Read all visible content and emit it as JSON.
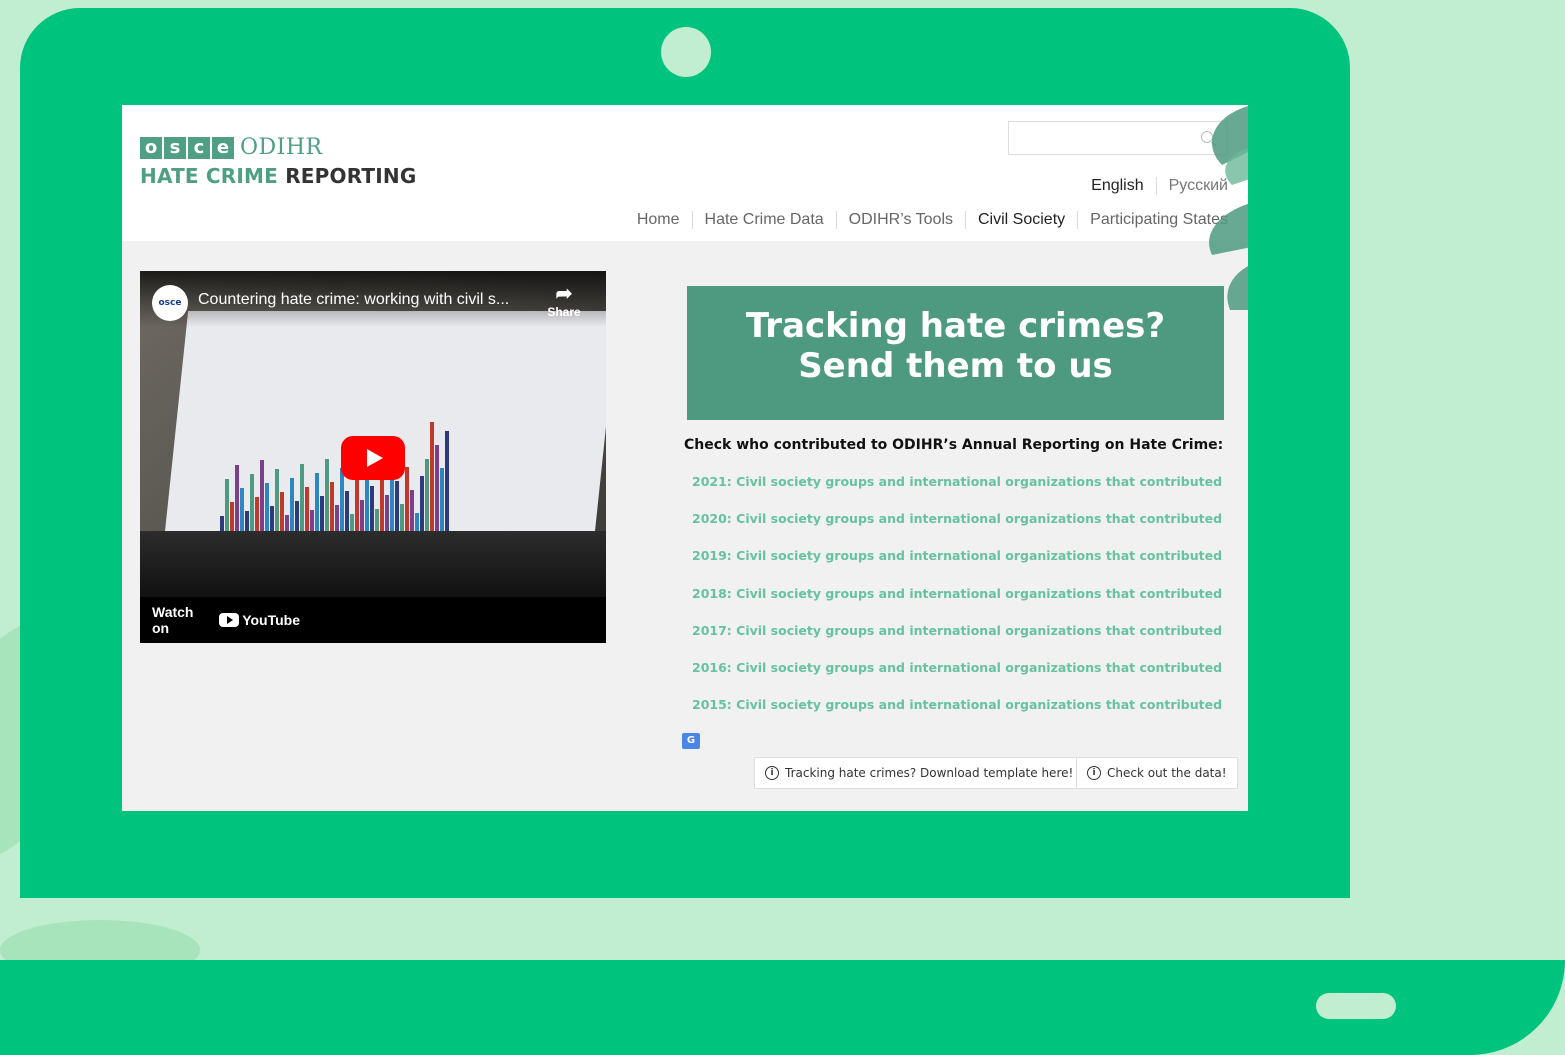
{
  "site": {
    "logo_osce_letters": [
      "o",
      "s",
      "c",
      "e"
    ],
    "logo_odihr": "ODIHR",
    "logo_hate_crime": "HATE CRIME",
    "logo_reporting": "REPORTING"
  },
  "search": {
    "placeholder": ""
  },
  "languages": {
    "english": "English",
    "russian": "Русский"
  },
  "nav": {
    "items": [
      {
        "label": "Home"
      },
      {
        "label": "Hate Crime Data"
      },
      {
        "label": "ODIHR’s Tools"
      },
      {
        "label": "Civil Society",
        "active": true
      },
      {
        "label": "Participating States"
      }
    ]
  },
  "video": {
    "channel_label": "osce",
    "title": "Countering hate crime: working with civil s...",
    "share_label": "Share",
    "watch_on": "Watch on",
    "youtube_label": "YouTube"
  },
  "banner": {
    "text": "Tracking hate crimes? Send them to us"
  },
  "contributions": {
    "heading": "Check who contributed to ODIHR’s Annual Reporting on Hate Crime:",
    "links": [
      "2021: Civil society groups and international organizations that contributed",
      "2020: Civil society groups and international organizations that contributed",
      "2019: Civil society groups and international organizations that contributed",
      "2018: Civil society groups and international organizations that contributed",
      "2017: Civil society groups and international organizations that contributed",
      "2016: Civil society groups and international organizations that contributed",
      "2015: Civil society groups and international organizations that contributed"
    ]
  },
  "buttons": {
    "download_template": "Tracking hate crimes? Download template here!",
    "check_data": "Check out the data!"
  },
  "colors": {
    "device_green": "#00c37d",
    "background": "#c1eed0",
    "brand_green": "#4e9a80",
    "link_green": "#66c2a0"
  }
}
